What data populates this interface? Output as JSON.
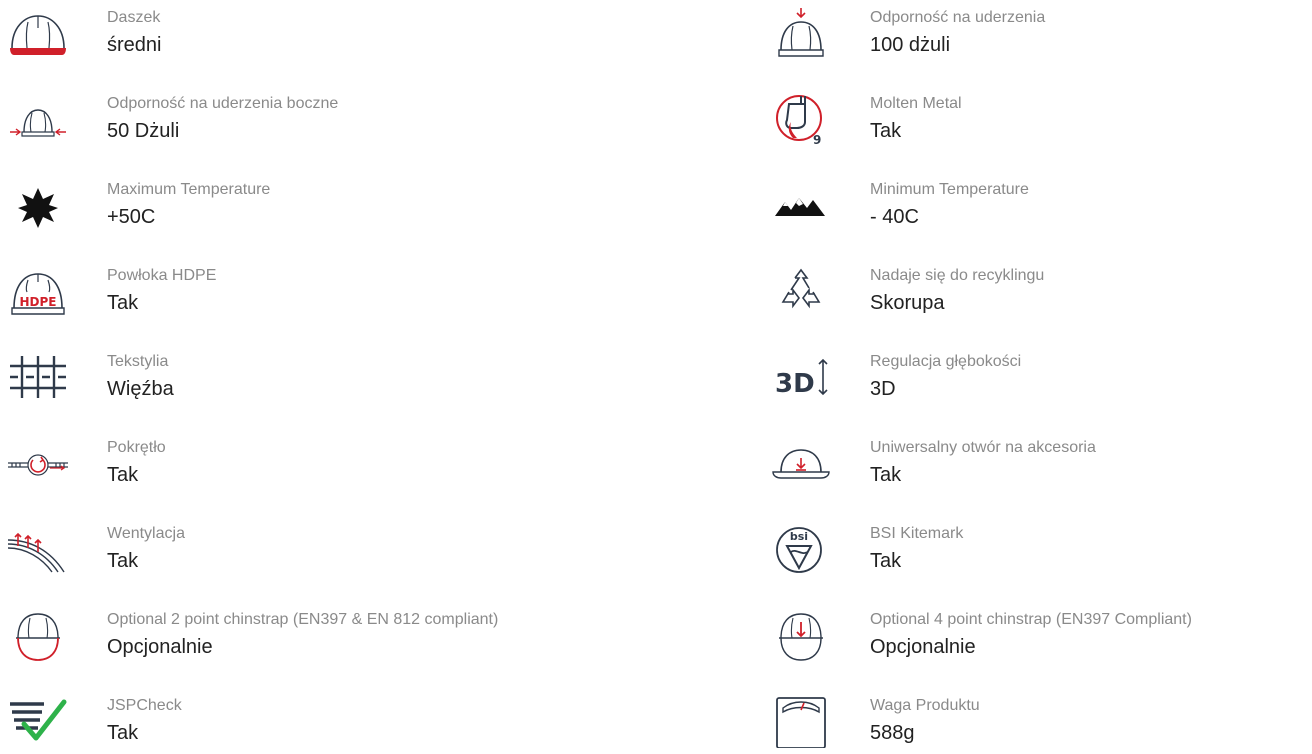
{
  "colors": {
    "icon_dark": "#2f3a4a",
    "icon_red": "#d0202a",
    "icon_green": "#2eb24a",
    "label": "#8a8a8a",
    "value": "#222222"
  },
  "specs": [
    {
      "label": "Daszek",
      "value": "średni",
      "icon": "helmet-peak-icon"
    },
    {
      "label": "Odporność na uderzenia",
      "value": "100 dżuli",
      "icon": "helmet-top-impact-icon"
    },
    {
      "label": "Odporność na uderzenia boczne",
      "value": "50 Dżuli",
      "icon": "helmet-side-impact-icon"
    },
    {
      "label": "Molten Metal",
      "value": "Tak",
      "icon": "molten-metal-icon"
    },
    {
      "label": "Maximum Temperature",
      "value": "+50C",
      "icon": "sun-icon"
    },
    {
      "label": "Minimum Temperature",
      "value": "- 40C",
      "icon": "mountains-icon"
    },
    {
      "label": "Powłoka HDPE",
      "value": "Tak",
      "icon": "helmet-hdpe-icon",
      "icon_text": "HDPE"
    },
    {
      "label": "Nadaje się do recyklingu",
      "value": "Skorupa",
      "icon": "recycle-icon"
    },
    {
      "label": "Tekstylia",
      "value": "Więźba",
      "icon": "textile-weave-icon"
    },
    {
      "label": "Regulacja głębokości",
      "value": "3D",
      "icon": "depth-adjust-3d-icon",
      "icon_text": "3D"
    },
    {
      "label": "Pokrętło",
      "value": "Tak",
      "icon": "wheel-ratchet-icon"
    },
    {
      "label": "Uniwersalny otwór na akcesoria",
      "value": "Tak",
      "icon": "helmet-accessory-slot-icon"
    },
    {
      "label": "Wentylacja",
      "value": "Tak",
      "icon": "ventilation-icon"
    },
    {
      "label": "BSI Kitemark",
      "value": "Tak",
      "icon": "bsi-kitemark-icon",
      "icon_text": "bsi"
    },
    {
      "label": "Optional 2 point chinstrap (EN397 & EN 812 compliant)",
      "value": "Opcjonalnie",
      "icon": "helmet-2-point-chinstrap-icon"
    },
    {
      "label": "Optional 4 point chinstrap (EN397 Compliant)",
      "value": "Opcjonalnie",
      "icon": "helmet-4-point-chinstrap-icon"
    },
    {
      "label": "JSPCheck",
      "value": "Tak",
      "icon": "jspcheck-icon"
    },
    {
      "label": "Waga Produktu",
      "value": "588g",
      "icon": "weight-scale-icon"
    }
  ]
}
